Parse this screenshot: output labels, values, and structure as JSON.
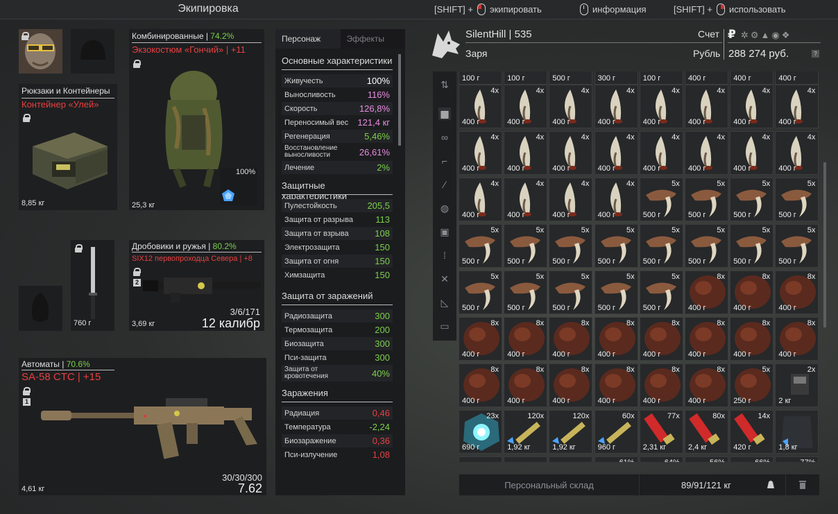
{
  "header": {
    "title": "Экипировка",
    "hint_equip_mod": "[SHIFT] +",
    "hint_equip": "экипировать",
    "hint_info": "информация",
    "hint_use_mod": "[SHIFT] +",
    "hint_use": "использовать"
  },
  "equipment": {
    "backpack": {
      "category": "Рюкзаки и Контейнеры",
      "name": "Контейнер «Улей»",
      "weight": "8,85 кг"
    },
    "armor": {
      "category": "Комбинированные",
      "percent": "74.2%",
      "name_line": "Экзокостюм «Гончий» | +11",
      "weight": "25,3 кг",
      "durability": "100%"
    },
    "knife_weight": "760 г",
    "shotgun": {
      "category": "Дробовики и ружья",
      "percent": "80.2%",
      "name_line": "SIX12 первопроходца Севера | +8",
      "ammo": "3/6/171",
      "caliber": "12 калибр",
      "weight": "3,69 кг",
      "slot_num": "2"
    },
    "rifle": {
      "category": "Автоматы",
      "percent": "70.6%",
      "name_line": "SA-58 CTC | +15",
      "ammo": "30/30/300",
      "caliber": "7.62",
      "weight": "4,61 кг",
      "slot_num": "1"
    }
  },
  "stats": {
    "tab_char": "Персонаж",
    "tab_effects": "Эффекты",
    "main_title": "Основные характеристики",
    "main": [
      {
        "label": "Живучесть",
        "value": "100%",
        "color": "#ffffff"
      },
      {
        "label": "Выносливость",
        "value": "116%",
        "color": "#e88be0"
      },
      {
        "label": "Скорость",
        "value": "126,8%",
        "color": "#e88be0"
      },
      {
        "label": "Переносимый вес",
        "value": "121,4 кг",
        "color": "#e88be0"
      },
      {
        "label": "Регенерация",
        "value": "5,46%",
        "color": "#7bd04b"
      },
      {
        "label": "Восстановление выносливости",
        "value": "26,61%",
        "color": "#e88be0"
      },
      {
        "label": "Лечение",
        "value": "2%",
        "color": "#7bd04b"
      }
    ],
    "protect_title": "Защитные характеристики",
    "protect": [
      {
        "label": "Пулестойкость",
        "value": "205,5"
      },
      {
        "label": "Защита от разрыва",
        "value": "113"
      },
      {
        "label": "Защита от взрыва",
        "value": "108"
      },
      {
        "label": "Электрозащита",
        "value": "150"
      },
      {
        "label": "Защита от огня",
        "value": "150"
      },
      {
        "label": "Химзащита",
        "value": "150"
      }
    ],
    "infect_prot_title": "Защита от заражений",
    "infect_prot": [
      {
        "label": "Радиозащита",
        "value": "300"
      },
      {
        "label": "Термозащита",
        "value": "200"
      },
      {
        "label": "Биозащита",
        "value": "300"
      },
      {
        "label": "Пси-защита",
        "value": "300"
      },
      {
        "label": "Защита от кровотечения",
        "value": "40%"
      }
    ],
    "infect_title": "Заражения",
    "infect": [
      {
        "label": "Радиация",
        "value": "0,46",
        "color": "#e84040"
      },
      {
        "label": "Температура",
        "value": "-2,24",
        "color": "#7bd04b"
      },
      {
        "label": "Биозаражение",
        "value": "0,36",
        "color": "#e84040"
      },
      {
        "label": "Пси-излучение",
        "value": "1,08",
        "color": "#e84040"
      }
    ]
  },
  "profile": {
    "name": "SilentHill | 535",
    "faction": "Заря",
    "account_label": "Счет",
    "currency_label": "Рубль",
    "money": "288 274 руб."
  },
  "inventory": {
    "top_partial": [
      "100 г",
      "100 г",
      "500 г",
      "300 г",
      "100 г",
      "400 г",
      "400 г",
      "400 г"
    ],
    "rows": [
      [
        [
          "4x",
          "400 г",
          "horn"
        ],
        [
          "4x",
          "400 г",
          "horn"
        ],
        [
          "4x",
          "400 г",
          "horn"
        ],
        [
          "4x",
          "400 г",
          "horn"
        ],
        [
          "4x",
          "400 г",
          "horn"
        ],
        [
          "4x",
          "400 г",
          "horn"
        ],
        [
          "4x",
          "400 г",
          "horn"
        ],
        [
          "4x",
          "400 г",
          "horn"
        ]
      ],
      [
        [
          "4x",
          "400 г",
          "horn"
        ],
        [
          "4x",
          "400 г",
          "horn"
        ],
        [
          "4x",
          "400 г",
          "horn"
        ],
        [
          "4x",
          "400 г",
          "horn"
        ],
        [
          "4x",
          "400 г",
          "horn"
        ],
        [
          "4x",
          "400 г",
          "horn"
        ],
        [
          "4x",
          "400 г",
          "horn"
        ],
        [
          "4x",
          "400 г",
          "horn"
        ]
      ],
      [
        [
          "4x",
          "400 г",
          "horn"
        ],
        [
          "4x",
          "400 г",
          "horn"
        ],
        [
          "4x",
          "400 г",
          "horn"
        ],
        [
          "4x",
          "400 г",
          "horn"
        ],
        [
          "5x",
          "500 г",
          "claw"
        ],
        [
          "5x",
          "500 г",
          "claw"
        ],
        [
          "5x",
          "500 г",
          "claw"
        ],
        [
          "5x",
          "500 г",
          "claw"
        ]
      ],
      [
        [
          "5x",
          "500 г",
          "claw"
        ],
        [
          "5x",
          "500 г",
          "claw"
        ],
        [
          "5x",
          "500 г",
          "claw"
        ],
        [
          "5x",
          "500 г",
          "claw"
        ],
        [
          "5x",
          "500 г",
          "claw"
        ],
        [
          "5x",
          "500 г",
          "claw"
        ],
        [
          "5x",
          "500 г",
          "claw"
        ],
        [
          "5x",
          "500 г",
          "claw"
        ]
      ],
      [
        [
          "5x",
          "500 г",
          "claw"
        ],
        [
          "5x",
          "500 г",
          "claw"
        ],
        [
          "5x",
          "500 г",
          "claw"
        ],
        [
          "5x",
          "500 г",
          "claw"
        ],
        [
          "5x",
          "500 г",
          "claw"
        ],
        [
          "8x",
          "400 г",
          "fur"
        ],
        [
          "8x",
          "400 г",
          "fur"
        ],
        [
          "8x",
          "400 г",
          "fur"
        ]
      ],
      [
        [
          "8x",
          "400 г",
          "fur"
        ],
        [
          "8x",
          "400 г",
          "fur"
        ],
        [
          "8x",
          "400 г",
          "fur"
        ],
        [
          "8x",
          "400 г",
          "fur"
        ],
        [
          "8x",
          "400 г",
          "fur"
        ],
        [
          "8x",
          "400 г",
          "fur"
        ],
        [
          "8x",
          "400 г",
          "fur"
        ],
        [
          "8x",
          "400 г",
          "fur"
        ]
      ],
      [
        [
          "8x",
          "400 г",
          "fur"
        ],
        [
          "8x",
          "400 г",
          "fur"
        ],
        [
          "8x",
          "400 г",
          "fur"
        ],
        [
          "8x",
          "400 г",
          "fur"
        ],
        [
          "8x",
          "400 г",
          "fur"
        ],
        [
          "8x",
          "400 г",
          "fur"
        ],
        [
          "5x",
          "250 г",
          "fur"
        ],
        [
          "2x",
          "2 кг",
          "device"
        ]
      ],
      [
        [
          "23x",
          "690 г",
          "orb"
        ],
        [
          "120x",
          "1,92 кг",
          "ammo"
        ],
        [
          "120x",
          "1,92 кг",
          "ammo"
        ],
        [
          "60x",
          "960 г",
          "ammo"
        ],
        [
          "77x",
          "2,31 кг",
          "shell"
        ],
        [
          "80x",
          "2,4 кг",
          "shell"
        ],
        [
          "14x",
          "420 г",
          "shell"
        ],
        [
          "",
          "1,8 кг",
          "vest"
        ]
      ]
    ],
    "bottom_partial": [
      "",
      "",
      "",
      "61%",
      "64%",
      "56%",
      "66%",
      "77%"
    ],
    "stash_label": "Персональный склад",
    "weight": "89/91/121 кг"
  },
  "colors": {
    "accent_red": "#e84040",
    "accent_green": "#7bd04b",
    "accent_pink": "#e88be0"
  }
}
